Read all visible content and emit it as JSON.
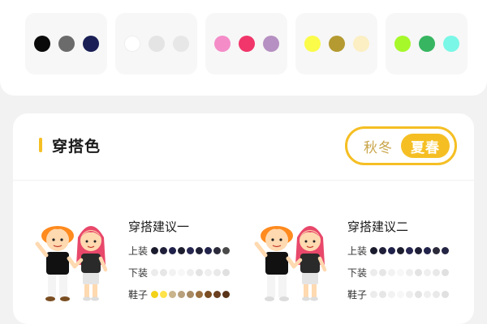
{
  "palettes": [
    {
      "name": "neutral-dark",
      "colors": [
        "#0a0a0a",
        "#6b6b6b",
        "#1a2055"
      ]
    },
    {
      "name": "neutral-light",
      "colors": [
        "#ffffff",
        "#e4e4e4",
        "#e7e7e7"
      ]
    },
    {
      "name": "pink",
      "colors": [
        "#f48cc8",
        "#f0366a",
        "#b690c2"
      ]
    },
    {
      "name": "yellow",
      "colors": [
        "#fbfb4a",
        "#b49a30",
        "#fbefc3"
      ]
    },
    {
      "name": "green",
      "colors": [
        "#a6f82a",
        "#37b561",
        "#7af7e6"
      ]
    }
  ],
  "section": {
    "title": "穿搭色",
    "season_off": "秋冬",
    "season_on": "夏春"
  },
  "labels": {
    "top": "上装",
    "bottom": "下装",
    "shoes": "鞋子"
  },
  "suggestions": [
    {
      "title": "穿搭建议一",
      "top_colors": [
        "#1b1b2e",
        "#1f1f3a",
        "#20214a",
        "#1d1d30",
        "#262650",
        "#1e1e36",
        "#22234a",
        "#2a2a3a",
        "#4a4a4a"
      ],
      "bottom_colors": [
        "#ececec",
        "#e6e6e6",
        "#f2f2f2",
        "#f7f7f7",
        "#eeeeee",
        "#e3e3e3",
        "#efefef",
        "#e9e9e9",
        "#e0e0e0"
      ],
      "shoe_colors": [
        "#f2d21a",
        "#ffe34a",
        "#c9b48c",
        "#b9a07c",
        "#a88a64",
        "#9a7040",
        "#7a4e22",
        "#6a4020",
        "#5a3418"
      ]
    },
    {
      "title": "穿搭建议二",
      "top_colors": [
        "#1b1b2e",
        "#1f1f3a",
        "#20214a",
        "#1d1d30",
        "#262650",
        "#1e1e36",
        "#22234a",
        "#2a2a3a",
        "#242444"
      ],
      "bottom_colors": [
        "#ececec",
        "#e6e6e6",
        "#f2f2f2",
        "#f7f7f7",
        "#eeeeee",
        "#e3e3e3",
        "#efefef",
        "#e9e9e9",
        "#e0e0e0"
      ],
      "shoe_colors": [
        "#ececec",
        "#e6e6e6",
        "#f2f2f2",
        "#f7f7f7",
        "#eeeeee",
        "#e3e3e3",
        "#efefef",
        "#e9e9e9",
        "#e0e0e0"
      ]
    }
  ],
  "accent_color": "#f5bf24"
}
